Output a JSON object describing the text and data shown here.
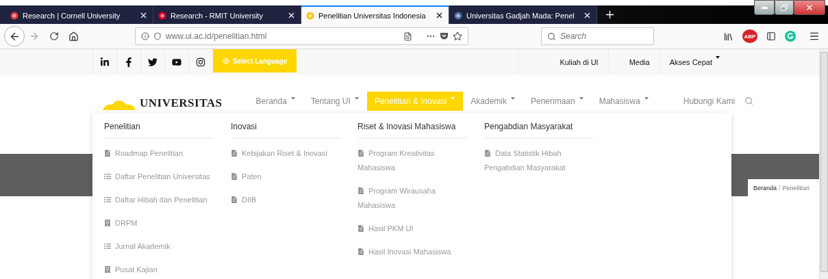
{
  "browser": {
    "tabs": [
      {
        "title": "Research | Cornell University",
        "selected": false
      },
      {
        "title": "Research - RMIT University",
        "selected": false
      },
      {
        "title": "Penelitian Universitas Indonesia",
        "selected": true
      },
      {
        "title": "Universitas Gadjah Mada: Penel",
        "selected": false
      }
    ],
    "address": "www.ui.ac.id/penelitian.html",
    "search": {
      "placeholder": "Search"
    },
    "adblock_badge": "ABP"
  },
  "topbar": {
    "language": "Select Language",
    "links": [
      {
        "label": "Kuliah di UI",
        "dropdown": false
      },
      {
        "label": "Media",
        "dropdown": false
      },
      {
        "label": "Akses Cepat",
        "dropdown": true
      }
    ]
  },
  "nav": {
    "logo_text": "UNIVERSITAS",
    "items": [
      {
        "label": "Beranda",
        "dropdown": true,
        "selected": false
      },
      {
        "label": "Tentang UI",
        "dropdown": true,
        "selected": false
      },
      {
        "label": "Penelitian & Inovasi",
        "dropdown": true,
        "selected": true
      },
      {
        "label": "Akademik",
        "dropdown": true,
        "selected": false
      },
      {
        "label": "Penerimaan",
        "dropdown": true,
        "selected": false
      },
      {
        "label": "Mahasiswa",
        "dropdown": true,
        "selected": false
      },
      {
        "label": "Hubungi Kami",
        "dropdown": false,
        "selected": false
      }
    ]
  },
  "mega_menu": {
    "columns": [
      {
        "heading": "Penelitian",
        "items": [
          {
            "label": "Roadmap Penelitian",
            "kind": "doc"
          },
          {
            "label": "Daftar Penelitian Universitas",
            "kind": "list"
          },
          {
            "label": "Daftar Hibah dan Penelitian",
            "kind": "list"
          },
          {
            "label": "DRPM",
            "kind": "building"
          },
          {
            "label": "Jurnal Akademik",
            "kind": "list"
          },
          {
            "label": "Pusat Kajian",
            "kind": "building"
          }
        ]
      },
      {
        "heading": "Inovasi",
        "items": [
          {
            "label": "Kebijakan Riset & Inovasi",
            "kind": "doc"
          },
          {
            "label": "Paten",
            "kind": "doc"
          },
          {
            "label": "DIIB",
            "kind": "doc"
          }
        ]
      },
      {
        "heading": "Riset & Inovasi Mahasiswa",
        "items": [
          {
            "label": "Program Kreativitas Mahasiswa",
            "kind": "doc"
          },
          {
            "label": "Program Wirausaha Mahasiswa",
            "kind": "doc"
          },
          {
            "label": "Hasil PKM UI",
            "kind": "doc"
          },
          {
            "label": "Hasil Inovasi Mahasiswa",
            "kind": "doc"
          }
        ]
      },
      {
        "heading": "Pengabdian Masyarakat",
        "items": [
          {
            "label": "Data Statistik Hibah Pengabdian Masyarakat",
            "kind": "doc"
          }
        ]
      }
    ]
  },
  "breadcrumb": {
    "items": [
      "Beranda",
      "Penelitian"
    ],
    "separator": "/"
  }
}
